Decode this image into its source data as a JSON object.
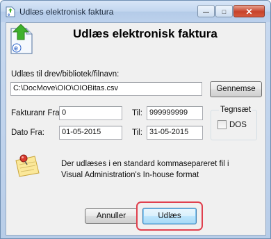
{
  "window": {
    "title": "Udlæs elektronisk faktura",
    "controls": {
      "minimize": "—",
      "maximize": "□",
      "close": "✕"
    }
  },
  "heading": "Udlæs elektronisk faktura",
  "file": {
    "label": "Udlæs til drev/bibliotek/filnavn:",
    "value": "C:\\DocMove\\OIO\\OIOBitas.csv",
    "browse_label": "Gennemse"
  },
  "invoice_range": {
    "from_label": "Fakturanr Fra:",
    "from_value": "0",
    "to_label": "Til:",
    "to_value": "999999999"
  },
  "date_range": {
    "from_label": "Dato Fra:",
    "from_value": "01-05-2015",
    "to_label": "Til:",
    "to_value": "31-05-2015"
  },
  "charset": {
    "group_label": "Tegnsæt",
    "dos_label": "DOS",
    "dos_checked": false
  },
  "info": {
    "line1": "Der udlæses i en standard kommasepareret fil i",
    "line2": "Visual Administration's In-house format",
    "icon": "note-pin-icon"
  },
  "actions": {
    "cancel_label": "Annuller",
    "export_label": "Udlæs"
  },
  "colors": {
    "highlight": "#e0404e",
    "titlebar": "#c2d6ef"
  }
}
